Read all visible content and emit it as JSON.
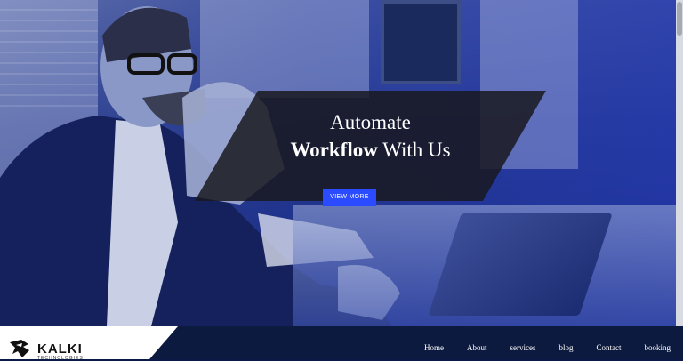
{
  "hero": {
    "headline_line1": "Automate",
    "headline_bold": "Workflow",
    "headline_rest": " With Us",
    "button_label": "VIEW MORE"
  },
  "brand": {
    "name": "KALKI",
    "tagline": "TECHNOLOGIES"
  },
  "nav": {
    "items": [
      "Home",
      "About",
      "services",
      "blog",
      "Contact",
      "booking"
    ]
  },
  "colors": {
    "button": "#2a4bff",
    "footer": "#0d1a3f",
    "banner": "#19191e"
  }
}
